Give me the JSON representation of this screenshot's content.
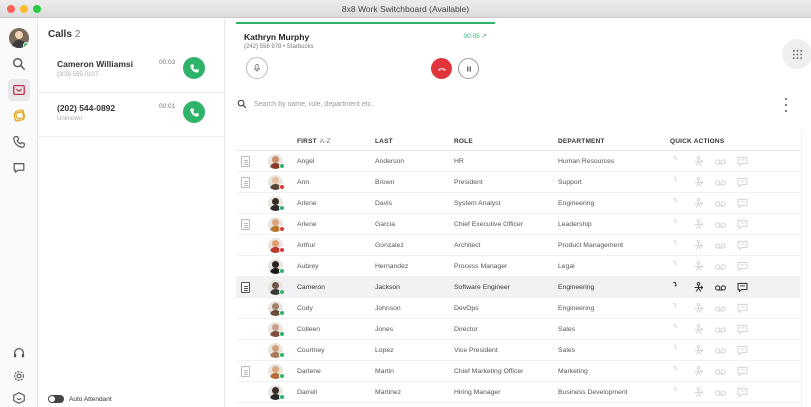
{
  "window": {
    "title": "8x8 Work Switchboard (Available)"
  },
  "calls": {
    "title": "Calls",
    "count": "2",
    "items": [
      {
        "name": "Cameron Williamsi",
        "sub": "(303) 555-0107",
        "time": "00:03"
      },
      {
        "name": "(202) 544-0892",
        "sub": "Unknown",
        "time": "00:01"
      }
    ],
    "auto_attendant_label": "Auto Attendant"
  },
  "active_call": {
    "name": "Kathryn Murphy",
    "sub": "(242) 556 978 • Starbucks",
    "time": "00:05"
  },
  "search": {
    "placeholder": "Search by name, role, department etc."
  },
  "table": {
    "headers": {
      "first": "FIRST",
      "first_sort": "A-Z",
      "last": "LAST",
      "role": "ROLE",
      "department": "DEPARTMENT",
      "quick_actions": "QUICK ACTIONS"
    },
    "rows": [
      {
        "first": "Angel",
        "last": "Anderson",
        "role": "HR",
        "department": "Human Resources",
        "doc": true,
        "status": "#2db56a",
        "skin": "#c98f6a",
        "cloth": "#8a3b2e"
      },
      {
        "first": "Ann",
        "last": "Brown",
        "role": "President",
        "department": "Support",
        "doc": true,
        "status": "#e0363b",
        "skin": "#e8c0a0",
        "cloth": "#5b4636"
      },
      {
        "first": "Arlene",
        "last": "Davis",
        "role": "System Analyst",
        "department": "Engineering",
        "doc": false,
        "status": "#2db56a",
        "skin": "#3a2c25",
        "cloth": "#2a2a2a"
      },
      {
        "first": "Arlene",
        "last": "Garcia",
        "role": "Chief Executive Officer",
        "department": "Leadership",
        "doc": true,
        "status": "#e0363b",
        "skin": "#d9a57a",
        "cloth": "#b5782f"
      },
      {
        "first": "Arthur",
        "last": "Gonzalez",
        "role": "Architect",
        "department": "Product Management",
        "doc": false,
        "status": "#e0363b",
        "skin": "#e0a070",
        "cloth": "#c0392b"
      },
      {
        "first": "Aubrey",
        "last": "Hernandez",
        "role": "Process Manager",
        "department": "Legal",
        "doc": false,
        "status": "#2db56a",
        "skin": "#2c2220",
        "cloth": "#1a1a1a"
      },
      {
        "first": "Cameron",
        "last": "Jackson",
        "role": "Software Engineer",
        "department": "Engineering",
        "doc": true,
        "status": "#2db56a",
        "skin": "#6e5648",
        "cloth": "#3b3b3b",
        "highlight": true
      },
      {
        "first": "Cody",
        "last": "Johnson",
        "role": "DevOps",
        "department": "Engineering",
        "doc": false,
        "status": "#2db56a",
        "skin": "#a07f6a",
        "cloth": "#6a4a3a"
      },
      {
        "first": "Colleen",
        "last": "Jones",
        "role": "Director",
        "department": "Sales",
        "doc": false,
        "status": "#2db56a",
        "skin": "#c9a087",
        "cloth": "#7c4f3e"
      },
      {
        "first": "Courtney",
        "last": "Lopez",
        "role": "Vice President",
        "department": "Sales",
        "doc": false,
        "status": "#2db56a",
        "skin": "#d3a07c",
        "cloth": "#a77c5a"
      },
      {
        "first": "Darlene",
        "last": "Martin",
        "role": "Chief Marketing Officer",
        "department": "Marketing",
        "doc": true,
        "status": "#2db56a",
        "skin": "#dca97f",
        "cloth": "#b56a3c"
      },
      {
        "first": "Darrell",
        "last": "Martinez",
        "role": "Hiring Manager",
        "department": "Business Development",
        "doc": false,
        "status": "#2db56a",
        "skin": "#3a2c25",
        "cloth": "#2a2a2a"
      }
    ]
  },
  "colors": {
    "accent_green": "#2fb36a",
    "hangup_red": "#e0363b",
    "quick_action_muted": "#d6d6d6",
    "quick_action_active": "#333333"
  },
  "icons": {
    "rail": [
      "search-icon",
      "switchboard-icon",
      "contacts-icon",
      "phone-icon",
      "chat-icon"
    ],
    "rail_bottom": [
      "support-icon",
      "settings-icon",
      "app-icon"
    ],
    "quick_actions": [
      "call-icon",
      "transfer-icon",
      "voicemail-icon",
      "message-icon"
    ]
  }
}
